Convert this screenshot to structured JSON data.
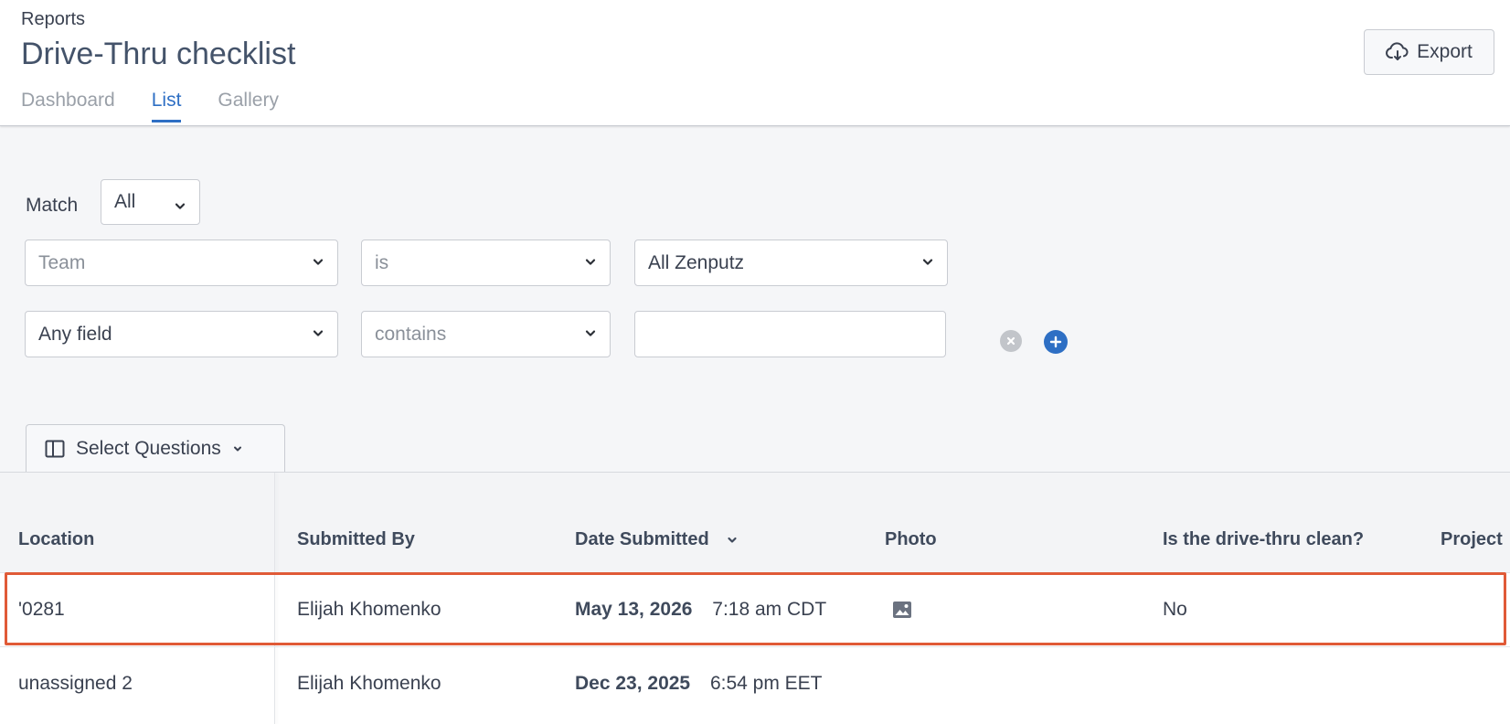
{
  "header": {
    "breadcrumb": "Reports",
    "title": "Drive-Thru checklist",
    "tabs": [
      {
        "label": "Dashboard",
        "active": false
      },
      {
        "label": "List",
        "active": true
      },
      {
        "label": "Gallery",
        "active": false
      }
    ],
    "export_label": "Export"
  },
  "filters": {
    "match_label": "Match",
    "match_value": "All",
    "rows": [
      {
        "field": "Team",
        "operator": "is",
        "value": "All Zenputz"
      },
      {
        "field": "Any field",
        "operator": "contains",
        "value": ""
      }
    ],
    "select_questions_label": "Select Questions"
  },
  "table": {
    "columns": [
      "Location",
      "Submitted By",
      "Date Submitted",
      "Photo",
      "Is the drive-thru clean?",
      "Project"
    ],
    "rows": [
      {
        "location": "'0281",
        "submitted_by": "Elijah Khomenko",
        "date": "May 13, 2026",
        "time": "7:18 am CDT",
        "photo": true,
        "clean": "No",
        "highlighted": true
      },
      {
        "location": "unassigned 2",
        "submitted_by": "Elijah Khomenko",
        "date": "Dec 23, 2025",
        "time": "6:54 pm EET",
        "photo": false,
        "clean": "",
        "highlighted": false
      }
    ]
  },
  "colors": {
    "accent": "#2e6fc4",
    "highlight_border": "#e05a37"
  },
  "icons": [
    "cloud-download-icon",
    "chevron-down-icon",
    "clear-icon",
    "plus-icon",
    "columns-icon",
    "photo-icon"
  ]
}
